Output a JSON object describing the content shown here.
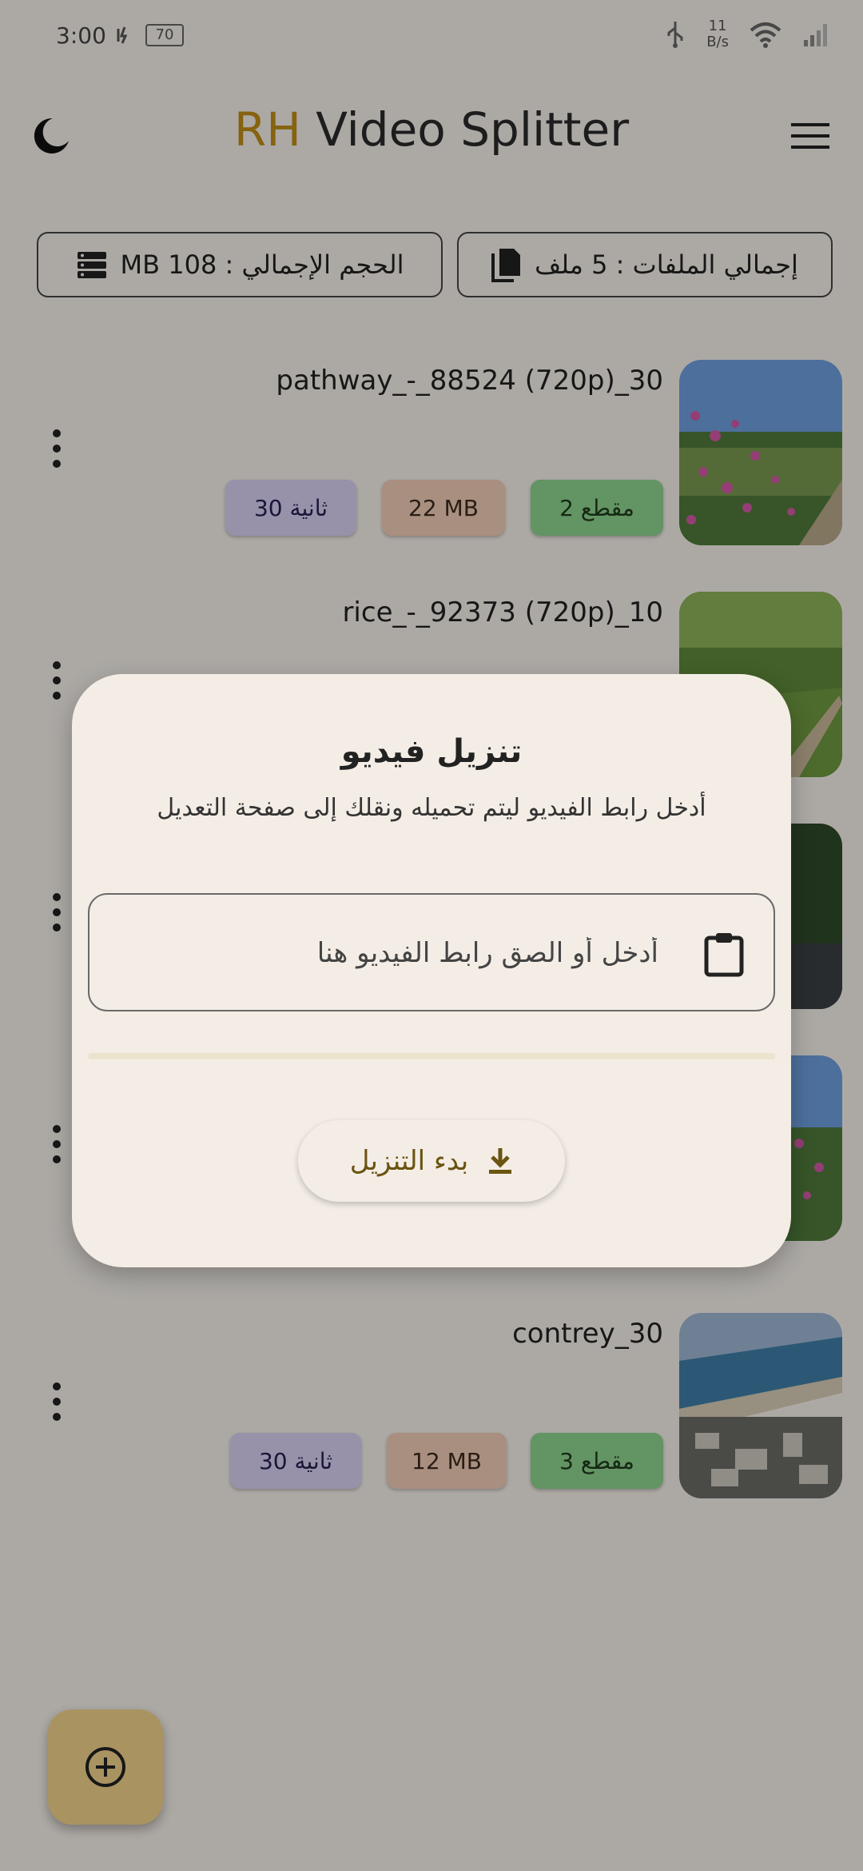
{
  "status_bar": {
    "time": "3:00",
    "battery": "70",
    "net_speed_value": "11",
    "net_speed_unit": "B/s"
  },
  "app": {
    "title_brand": "RH",
    "title_rest": " Video Splitter"
  },
  "stats": {
    "total_files": "إجمالي الملفات : 5 ملف",
    "total_size": "الحجم الإجمالي : 108 MB"
  },
  "videos": [
    {
      "name": "pathway_-_88524 (720p)_30",
      "segments": "2 مقطع",
      "size": "22 MB",
      "duration": "30 ثانية"
    },
    {
      "name": "rice_-_92373 (720p)_10"
    },
    {
      "name": ""
    },
    {
      "name": ""
    },
    {
      "name": "contrey_30",
      "segments": "3 مقطع",
      "size": "12 MB",
      "duration": "30 ثانية"
    }
  ],
  "dialog": {
    "title": "تنزيل فيديو",
    "subtitle": "أدخل رابط الفيديو ليتم تحميله ونقلك إلى صفحة التعديل",
    "input_placeholder": "أدخل أو الصق رابط الفيديو هنا",
    "input_value": "",
    "progress": 0,
    "download_button": "بدء التنزيل"
  },
  "colors": {
    "brand": "#c08f17",
    "chip_segments": "#8fd48f",
    "chip_size": "#f3cdb6",
    "chip_duration": "#d8d2f4",
    "fab": "#f3d38a"
  },
  "icons": {
    "theme": "moon-icon",
    "menu": "menu-icon",
    "files": "file-copy-icon",
    "storage": "storage-icon",
    "more": "more-vert-icon",
    "clipboard": "clipboard-icon",
    "download": "download-icon",
    "add": "add-circle-icon"
  }
}
